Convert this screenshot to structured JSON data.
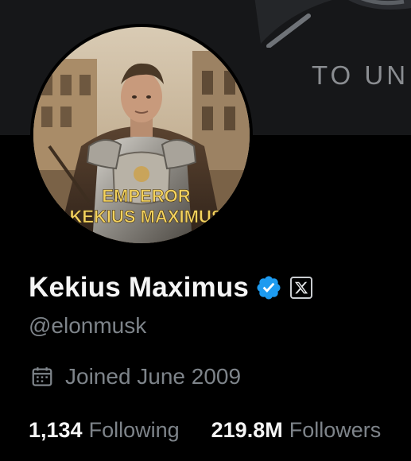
{
  "banner": {
    "text": "TO UN"
  },
  "avatar": {
    "caption_line1": "EMPEROR",
    "caption_line2": "KEKIUS MAXIMUS"
  },
  "profile": {
    "display_name": "Kekius Maximus",
    "verified_icon": "verified-badge-icon",
    "affiliate_icon": "x-logo-icon",
    "handle": "@elonmusk",
    "joined": "Joined June 2009",
    "following_count": "1,134",
    "following_label": "Following",
    "followers_count": "219.8M",
    "followers_label": "Followers"
  },
  "colors": {
    "background": "#000000",
    "banner": "#161719",
    "verified_blue": "#1d9bf0",
    "primary_text": "#e7e9ea",
    "secondary_text": "#71767b",
    "caption_gold": "#f4d35e"
  }
}
